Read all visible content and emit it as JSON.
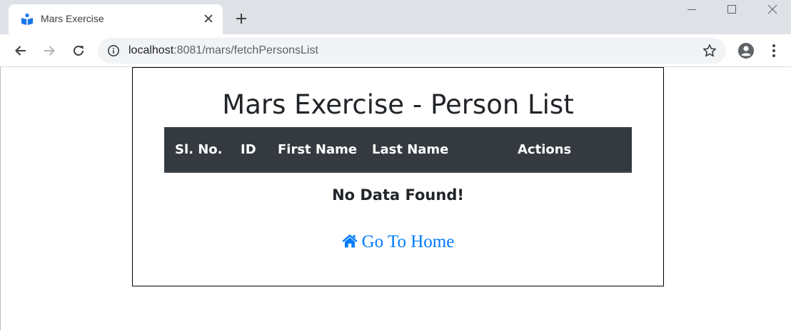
{
  "browser": {
    "tab": {
      "title": "Mars Exercise"
    },
    "address_bar": {
      "url_host": "localhost",
      "url_path": ":8081/mars/fetchPersonsList"
    }
  },
  "page": {
    "title": "Mars Exercise - Person List",
    "table": {
      "headers": [
        "Sl. No.",
        "ID",
        "First Name",
        "Last Name",
        "Actions"
      ],
      "rows": []
    },
    "empty_message": "No Data Found!",
    "home_link": {
      "label": "Go To Home",
      "icon": "home-icon"
    }
  },
  "colors": {
    "table_header_bg": "#343a40",
    "link": "#007bff",
    "favicon": "#1a73e8"
  }
}
